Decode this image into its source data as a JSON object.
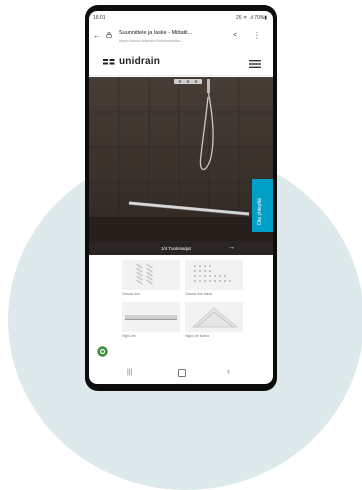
{
  "status_bar": {
    "time": "16:01",
    "icons_text": "26 ᯤ .ıl 70%▮"
  },
  "browser": {
    "page_title": "Suunnittele ja laske - Mittatil...",
    "url": "https://www.unidrain.fi/n/ammattila..."
  },
  "site": {
    "logo_text": "unidrain",
    "brand_color": "#00a0c6",
    "hero_link_label": "1/4 Tuotesarjat",
    "side_tab_label": "Ota yhteyttä"
  },
  "products": [
    {
      "label": "Classic-line"
    },
    {
      "label": "Classic-line kansi"
    },
    {
      "label": "HighLine"
    },
    {
      "label": "HighLine kulma"
    }
  ],
  "icons": [
    "back-arrow-icon",
    "lock-icon",
    "share-icon",
    "more-vert-icon",
    "hamburger-menu-icon",
    "chat-icon",
    "recents-icon",
    "home-icon",
    "back-icon"
  ]
}
